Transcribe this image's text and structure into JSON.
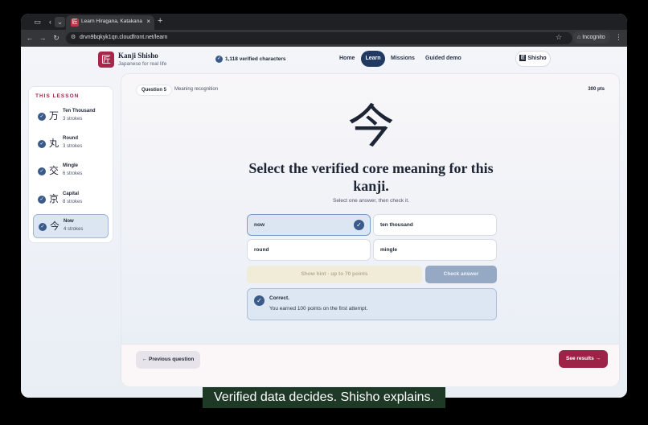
{
  "browser": {
    "tab_title": "Learn Hiragana, Katakana, an",
    "tab_favicon": "匠",
    "url": "drvn9bqkyk1qn.cloudfront.net/learn",
    "profile_label": "Incognito"
  },
  "header": {
    "logo_glyph": "匠",
    "brand": "Kanji Shisho",
    "tagline": "Japanese for real life",
    "verified": "1,118 verified characters",
    "nav": [
      "Home",
      "Learn",
      "Missions",
      "Guided demo"
    ],
    "user_label": "Shisho",
    "user_icon": "匠"
  },
  "lesson": {
    "title": "THIS LESSON",
    "items": [
      {
        "kanji": "万",
        "name": "Ten Thousand",
        "strokes": "3 strokes"
      },
      {
        "kanji": "丸",
        "name": "Round",
        "strokes": "3 strokes"
      },
      {
        "kanji": "交",
        "name": "Mingle",
        "strokes": "6 strokes"
      },
      {
        "kanji": "京",
        "name": "Capital",
        "strokes": "8 strokes"
      },
      {
        "kanji": "今",
        "name": "Now",
        "strokes": "4 strokes"
      }
    ]
  },
  "quiz": {
    "question_badge": "Question 5",
    "question_type": "Meaning recognition",
    "points": "300 pts",
    "kanji": "今",
    "question": "Select the verified core meaning for this kanji.",
    "instruction": "Select one answer, then check it.",
    "options": [
      "now",
      "ten thousand",
      "round",
      "mingle"
    ],
    "hint_label": "Show hint · up to 70 points",
    "check_label": "Check answer",
    "feedback_title": "Correct.",
    "feedback_message": "You earned 100 points on the first attempt."
  },
  "footer": {
    "prev_label": "← Previous question",
    "results_label": "See results →"
  },
  "caption": "Verified data decides. Shisho explains.",
  "colors": {
    "brand": "#a8264a",
    "accent": "#213a63",
    "check": "#3a5b8a"
  }
}
